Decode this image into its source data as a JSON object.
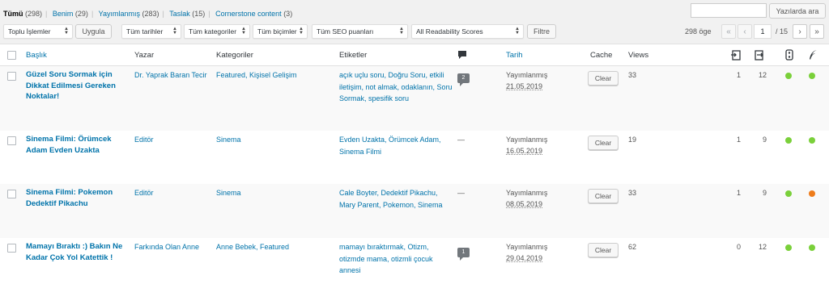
{
  "filters": {
    "all": {
      "label": "Tümü",
      "count": "(298)"
    },
    "mine": {
      "label": "Benim",
      "count": "(29)"
    },
    "published": {
      "label": "Yayımlanmış",
      "count": "(283)"
    },
    "draft": {
      "label": "Taslak",
      "count": "(15)"
    },
    "cornerstone": {
      "label": "Cornerstone content",
      "count": "(3)"
    }
  },
  "search": {
    "button_label": "Yazılarda ara",
    "value": ""
  },
  "toolbar": {
    "bulk_actions": "Toplu İşlemler",
    "apply_label": "Uygula",
    "dates": "Tüm tarihler",
    "categories": "Tüm kategoriler",
    "formats": "Tüm biçimler",
    "seo_scores": "Tüm SEO puanları",
    "readability": "All Readability Scores",
    "filter_label": "Filtre"
  },
  "pagination": {
    "items": "298 öge",
    "first": "«",
    "prev": "‹",
    "current_page": "1",
    "total_pages": "/ 15",
    "next": "›",
    "last": "»"
  },
  "columns": {
    "title": "Başlık",
    "author": "Yazar",
    "categories": "Kategoriler",
    "tags": "Etiketler",
    "date": "Tarih",
    "cache": "Cache",
    "views": "Views"
  },
  "colors": {
    "good": "#7ad03a",
    "ok": "#ee7c1b",
    "link": "#0073aa"
  },
  "rows": [
    {
      "title": "Güzel Soru Sormak için Dikkat Edilmesi Gereken Noktalar!",
      "author": "Dr. Yaprak Baran Tecir",
      "categories": "Featured, Kişisel Gelişim",
      "tags": "açık uçlu soru, Doğru Soru, etkili iletişim, not almak, odaklanın, Soru Sormak, spesifik soru",
      "comments": "2",
      "status": "Yayımlanmış",
      "date": "21.05.2019",
      "cache": "Clear",
      "views": "33",
      "links_out": "1",
      "links_in": "12",
      "seo": "good",
      "readability": "good"
    },
    {
      "title": "Sinema Filmi: Örümcek Adam Evden Uzakta",
      "author": "Editör",
      "categories": "Sinema",
      "tags": "Evden Uzakta, Örümcek Adam, Sinema Filmi",
      "comments": "—",
      "status": "Yayımlanmış",
      "date": "16.05.2019",
      "cache": "Clear",
      "views": "19",
      "links_out": "1",
      "links_in": "9",
      "seo": "good",
      "readability": "good"
    },
    {
      "title": "Sinema Filmi: Pokemon Dedektif Pikachu",
      "author": "Editör",
      "categories": "Sinema",
      "tags": "Cale Boyter, Dedektif Pikachu, Mary Parent, Pokemon, Sinema",
      "comments": "—",
      "status": "Yayımlanmış",
      "date": "08.05.2019",
      "cache": "Clear",
      "views": "33",
      "links_out": "1",
      "links_in": "9",
      "seo": "good",
      "readability": "ok"
    },
    {
      "title": "Mamayı Bıraktı :) Bakın Ne Kadar Çok Yol Katettik !",
      "author": "Farkında Olan Anne",
      "categories": "Anne Bebek, Featured",
      "tags": "mamayı bıraktırmak, Otizm, otizmde mama, otizmli çocuk annesi",
      "comments": "1",
      "status": "Yayımlanmış",
      "date": "29.04.2019",
      "cache": "Clear",
      "views": "62",
      "links_out": "0",
      "links_in": "12",
      "seo": "good",
      "readability": "good"
    }
  ]
}
